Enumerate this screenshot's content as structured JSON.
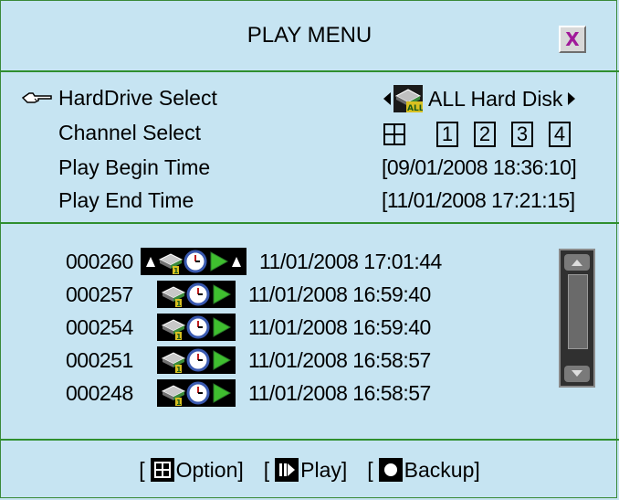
{
  "title": "PLAY MENU",
  "close_label": "X",
  "settings": {
    "harddrive_label": "HardDrive Select",
    "harddrive_value": "ALL Hard Disk",
    "channel_label": "Channel Select",
    "channels": [
      "1",
      "2",
      "3",
      "4"
    ],
    "begin_label": "Play Begin Time",
    "begin_value": "[09/01/2008  18:36:10]",
    "end_label": "Play End Time",
    "end_value": "[11/01/2008  17:21:15]"
  },
  "records": [
    {
      "id": "000260",
      "datetime": "11/01/2008  17:01:44"
    },
    {
      "id": "000257",
      "datetime": "11/01/2008  16:59:40"
    },
    {
      "id": "000254",
      "datetime": "11/01/2008  16:59:40"
    },
    {
      "id": "000251",
      "datetime": "11/01/2008  16:58:57"
    },
    {
      "id": "000248",
      "datetime": "11/01/2008  16:58:57"
    }
  ],
  "footer": {
    "option_label": "Option]",
    "play_label": "Play]",
    "backup_label": "Backup]",
    "open_bracket": "["
  },
  "icons": {
    "pointer": "hand-pointer-icon",
    "harddisk": "all-harddisk-icon",
    "grid": "quad-grid-icon",
    "record": [
      "harddisk-icon",
      "clock-icon",
      "play-icon"
    ]
  },
  "colors": {
    "background": "#c6e4f2",
    "divider": "#2f8f2f",
    "close_x": "#a01a9a",
    "play_green": "#3fbf2f"
  }
}
